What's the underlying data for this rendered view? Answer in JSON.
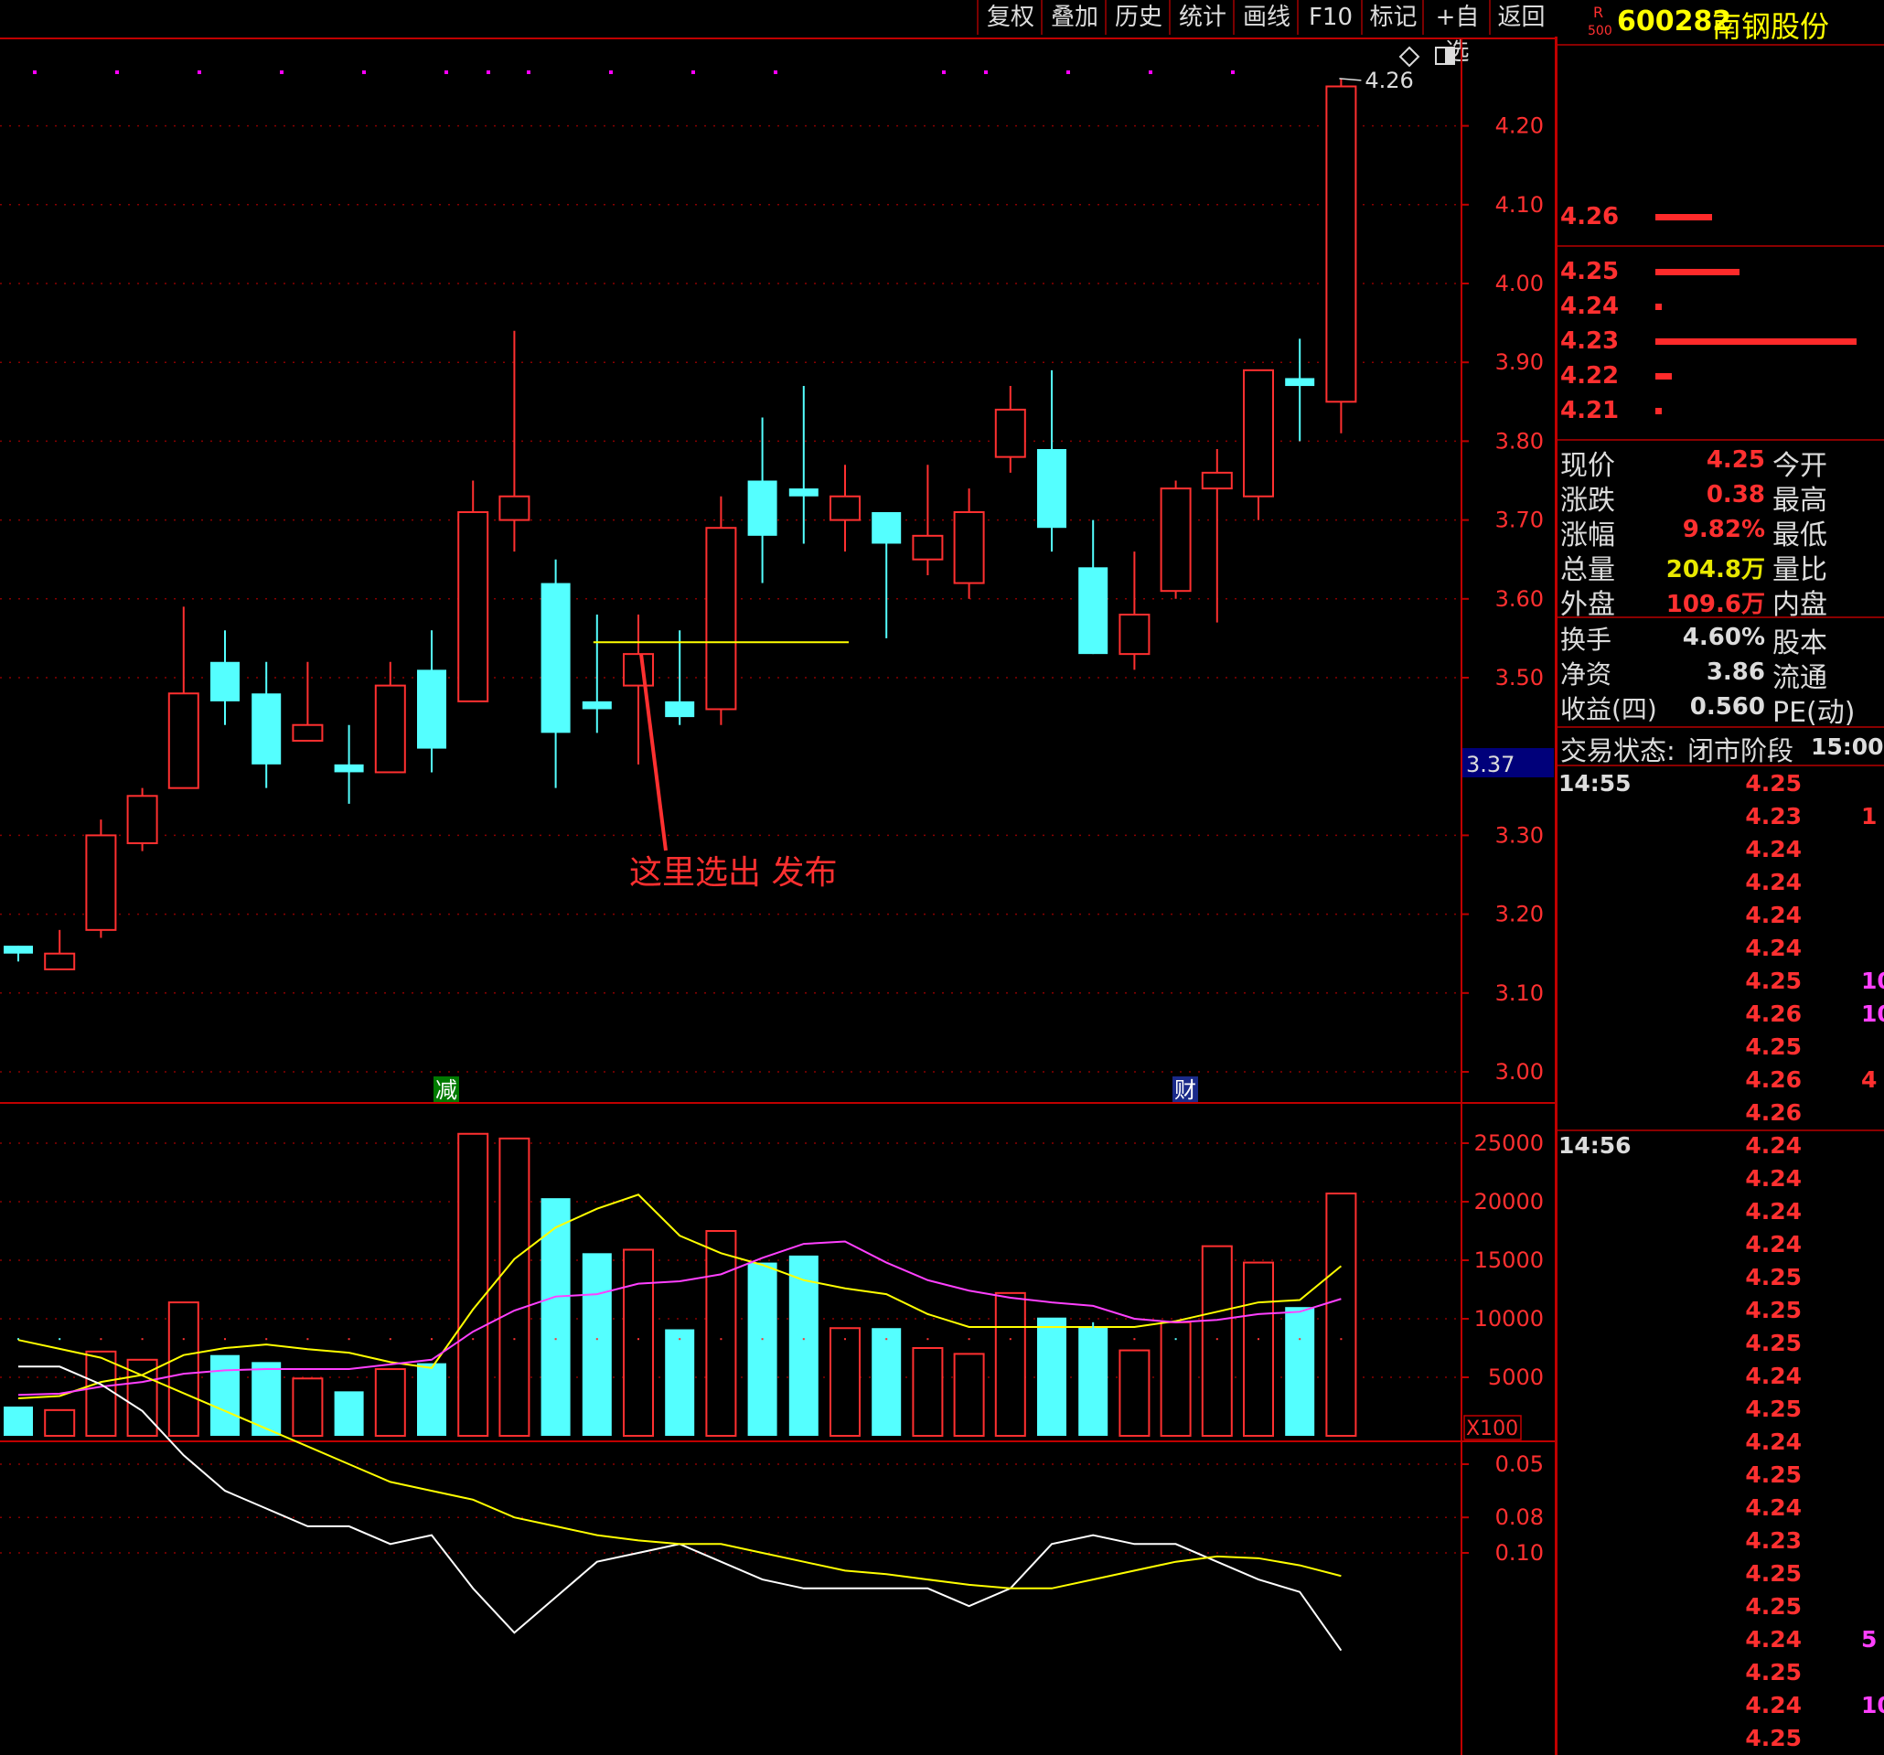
{
  "toolbar": {
    "buttons": [
      "复权",
      "叠加",
      "历史",
      "统计",
      "画线",
      "F10",
      "标记",
      "+自选",
      "返回"
    ]
  },
  "stock": {
    "badge_top": "R",
    "badge_bottom": "500",
    "code": "600282",
    "name": "南钢股份"
  },
  "order_book": {
    "ask": [
      {
        "price": "4.26",
        "size": 0.28
      }
    ],
    "bid": [
      {
        "price": "4.25",
        "size": 0.42
      },
      {
        "price": "4.24",
        "size": 0.03
      },
      {
        "price": "4.23",
        "size": 1.0
      },
      {
        "price": "4.22",
        "size": 0.08
      },
      {
        "price": "4.21",
        "size": 0.03
      }
    ]
  },
  "quote": [
    {
      "label": "现价",
      "value": "4.25",
      "color": "#ff3030",
      "label2": "今开"
    },
    {
      "label": "涨跌",
      "value": "0.38",
      "color": "#ff3030",
      "label2": "最高"
    },
    {
      "label": "涨幅",
      "value": "9.82%",
      "color": "#ff3030",
      "label2": "最低"
    },
    {
      "label": "总量",
      "value": "204.8万",
      "color": "#e8e800",
      "label2": "量比"
    },
    {
      "label": "外盘",
      "value": "109.6万",
      "color": "#ff3030",
      "label2": "内盘"
    }
  ],
  "fundamentals": [
    {
      "label": "换手",
      "value": "4.60%",
      "label2": "股本"
    },
    {
      "label": "净资",
      "value": "3.86",
      "label2": "流通"
    },
    {
      "label": "收益(四)",
      "value": "0.560",
      "label2": "PE(动)"
    }
  ],
  "trading_status": {
    "label": "交易状态:",
    "status": "闭市阶段",
    "time": "15:00:"
  },
  "ticks": [
    {
      "time": "14:55",
      "prices": [
        "4.25",
        "4.23",
        "4.24",
        "4.24",
        "4.24",
        "4.24",
        "4.25",
        "4.26",
        "4.25",
        "4.26",
        "4.26"
      ],
      "extras": [
        "",
        "1",
        "",
        "",
        "",
        "",
        "10",
        "10",
        "",
        "4",
        ""
      ]
    },
    {
      "time": "14:56",
      "prices": [
        "4.24",
        "4.24",
        "4.24",
        "4.24",
        "4.25",
        "4.25",
        "4.25",
        "4.24",
        "4.25",
        "4.24",
        "4.25",
        "4.24",
        "4.23",
        "4.25",
        "4.25",
        "4.24",
        "4.25",
        "4.24",
        "4.25"
      ],
      "extras": [
        "",
        "",
        "",
        "",
        "",
        "",
        "",
        "",
        "",
        "",
        "",
        "",
        "",
        "",
        "",
        "5",
        "",
        "10",
        ""
      ]
    }
  ],
  "chart_data": {
    "type": "candlestick",
    "price_axis": {
      "ticks": [
        "4.20",
        "4.10",
        "4.00",
        "3.90",
        "3.80",
        "3.70",
        "3.60",
        "3.50",
        "3.30",
        "3.20",
        "3.10",
        "3.00"
      ],
      "ylim": [
        2.98,
        4.28
      ]
    },
    "current_price_tag": "3.37",
    "high_label": "4.26",
    "annotation": "这里选出 发布",
    "markers": [
      "减",
      "财"
    ],
    "candles": [
      {
        "o": 3.16,
        "c": 3.15,
        "h": 3.16,
        "l": 3.14,
        "up": false
      },
      {
        "o": 3.13,
        "c": 3.15,
        "h": 3.18,
        "l": 3.13,
        "up": true
      },
      {
        "o": 3.18,
        "c": 3.3,
        "h": 3.32,
        "l": 3.17,
        "up": true
      },
      {
        "o": 3.29,
        "c": 3.35,
        "h": 3.36,
        "l": 3.28,
        "up": true
      },
      {
        "o": 3.36,
        "c": 3.48,
        "h": 3.59,
        "l": 3.36,
        "up": true
      },
      {
        "o": 3.52,
        "c": 3.47,
        "h": 3.56,
        "l": 3.44,
        "up": false
      },
      {
        "o": 3.48,
        "c": 3.39,
        "h": 3.52,
        "l": 3.36,
        "up": false
      },
      {
        "o": 3.42,
        "c": 3.44,
        "h": 3.52,
        "l": 3.42,
        "up": true
      },
      {
        "o": 3.39,
        "c": 3.38,
        "h": 3.44,
        "l": 3.34,
        "up": false
      },
      {
        "o": 3.38,
        "c": 3.49,
        "h": 3.52,
        "l": 3.38,
        "up": true
      },
      {
        "o": 3.51,
        "c": 3.41,
        "h": 3.56,
        "l": 3.38,
        "up": false
      },
      {
        "o": 3.47,
        "c": 3.71,
        "h": 3.75,
        "l": 3.47,
        "up": true
      },
      {
        "o": 3.7,
        "c": 3.73,
        "h": 3.94,
        "l": 3.66,
        "up": true
      },
      {
        "o": 3.62,
        "c": 3.43,
        "h": 3.65,
        "l": 3.36,
        "up": false
      },
      {
        "o": 3.47,
        "c": 3.46,
        "h": 3.58,
        "l": 3.43,
        "up": false
      },
      {
        "o": 3.49,
        "c": 3.53,
        "h": 3.58,
        "l": 3.39,
        "up": true
      },
      {
        "o": 3.47,
        "c": 3.45,
        "h": 3.56,
        "l": 3.44,
        "up": false
      },
      {
        "o": 3.46,
        "c": 3.69,
        "h": 3.73,
        "l": 3.44,
        "up": true
      },
      {
        "o": 3.75,
        "c": 3.68,
        "h": 3.83,
        "l": 3.62,
        "up": false
      },
      {
        "o": 3.74,
        "c": 3.73,
        "h": 3.87,
        "l": 3.67,
        "up": false
      },
      {
        "o": 3.7,
        "c": 3.73,
        "h": 3.77,
        "l": 3.66,
        "up": true
      },
      {
        "o": 3.71,
        "c": 3.67,
        "h": 3.71,
        "l": 3.55,
        "up": false
      },
      {
        "o": 3.65,
        "c": 3.68,
        "h": 3.77,
        "l": 3.63,
        "up": true
      },
      {
        "o": 3.62,
        "c": 3.71,
        "h": 3.74,
        "l": 3.6,
        "up": true
      },
      {
        "o": 3.78,
        "c": 3.84,
        "h": 3.87,
        "l": 3.76,
        "up": true
      },
      {
        "o": 3.79,
        "c": 3.69,
        "h": 3.89,
        "l": 3.66,
        "up": false
      },
      {
        "o": 3.64,
        "c": 3.53,
        "h": 3.7,
        "l": 3.53,
        "up": false
      },
      {
        "o": 3.53,
        "c": 3.58,
        "h": 3.66,
        "l": 3.51,
        "up": true
      },
      {
        "o": 3.61,
        "c": 3.74,
        "h": 3.75,
        "l": 3.6,
        "up": true
      },
      {
        "o": 3.74,
        "c": 3.76,
        "h": 3.79,
        "l": 3.57,
        "up": true
      },
      {
        "o": 3.73,
        "c": 3.89,
        "h": 3.89,
        "l": 3.7,
        "up": true
      },
      {
        "o": 3.88,
        "c": 3.87,
        "h": 3.93,
        "l": 3.8,
        "up": false
      },
      {
        "o": 3.85,
        "c": 4.25,
        "h": 4.26,
        "l": 3.81,
        "up": true
      }
    ],
    "volume_axis": {
      "ticks": [
        "25000",
        "20000",
        "15000",
        "10000",
        "5000"
      ],
      "unit": "X100",
      "ylim": [
        0,
        26000
      ]
    },
    "volumes": [
      2500,
      2200,
      7200,
      6500,
      11400,
      6900,
      6300,
      4900,
      3800,
      5700,
      6200,
      25800,
      25400,
      20300,
      15600,
      15900,
      9100,
      17500,
      14800,
      15400,
      9200,
      9200,
      7500,
      7000,
      12200,
      10100,
      9300,
      7300,
      9700,
      16200,
      14800,
      11000,
      20700
    ],
    "vol_ma5": [
      3200,
      3400,
      4600,
      5200,
      6900,
      7500,
      7800,
      7400,
      7100,
      6300,
      5800,
      10800,
      15100,
      17800,
      19400,
      20600,
      17100,
      15600,
      14600,
      13300,
      12600,
      12100,
      10400,
      9300,
      9300,
      9300,
      9300,
      9300,
      9800,
      10600,
      11400,
      11600,
      14500
    ],
    "vol_ma10": [
      3500,
      3600,
      4200,
      4600,
      5300,
      5600,
      5700,
      5700,
      5700,
      6100,
      6500,
      8900,
      10700,
      11900,
      12100,
      13000,
      13200,
      13800,
      15200,
      16400,
      16600,
      14800,
      13300,
      12400,
      11800,
      11400,
      11100,
      10000,
      9700,
      9900,
      10400,
      10600,
      11700
    ],
    "indicator_axis": {
      "ticks": [
        "0.10",
        "0.08",
        "0.05"
      ],
      "ylim": [
        -0.02,
        0.165
      ]
    },
    "ind_white": [
      -0.005,
      -0.005,
      0.005,
      0.02,
      0.045,
      0.065,
      0.075,
      0.085,
      0.085,
      0.095,
      0.09,
      0.12,
      0.145,
      0.125,
      0.105,
      0.1,
      0.095,
      0.105,
      0.115,
      0.12,
      0.12,
      0.12,
      0.12,
      0.13,
      0.12,
      0.095,
      0.09,
      0.095,
      0.095,
      0.105,
      0.115,
      0.122,
      0.155
    ],
    "ind_yellow": [
      -0.02,
      -0.015,
      -0.01,
      0.0,
      0.01,
      0.02,
      0.03,
      0.04,
      0.05,
      0.06,
      0.065,
      0.07,
      0.08,
      0.085,
      0.09,
      0.093,
      0.095,
      0.095,
      0.1,
      0.105,
      0.11,
      0.112,
      0.115,
      0.118,
      0.12,
      0.12,
      0.115,
      0.11,
      0.105,
      0.102,
      0.103,
      0.107,
      0.113
    ],
    "ind_bars": [
      -0.02,
      -0.015,
      0.002,
      0.015,
      0.075,
      0.09,
      0.08,
      0.07,
      0.05,
      0.05,
      0.055,
      0.07,
      0.088,
      0.05,
      0.02,
      0.01,
      0.0,
      0.005,
      0.02,
      0.02,
      0.015,
      0.01,
      0.008,
      0.008,
      0.0,
      -0.02,
      -0.03,
      -0.01,
      -0.02,
      0.0,
      0.01,
      0.015,
      0.068
    ]
  }
}
